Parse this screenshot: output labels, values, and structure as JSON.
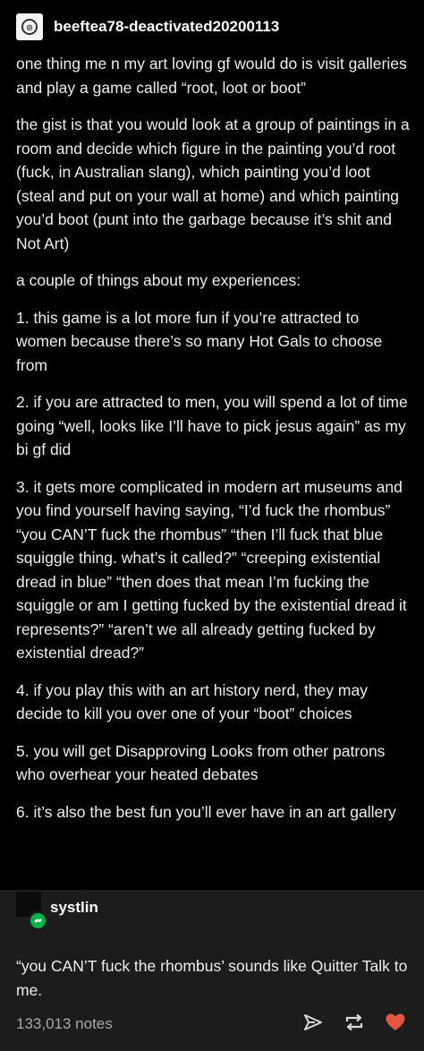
{
  "op": {
    "username": "beeftea78-deactivated20200113",
    "paragraphs": [
      "one thing me n my art loving gf would do is visit galleries and play a game called “root, loot or boot”",
      "the gist is that you would look at a group of paintings in a room and decide which figure in the painting you’d root (fuck, in Australian slang), which painting you’d loot (steal and put on your wall at home) and which painting you’d boot (punt into the garbage because it’s shit and Not Art)",
      "a couple of things about my experiences:",
      "1. this game is a lot more fun if you’re attracted to women because there’s so many Hot Gals to choose from",
      "2. if you are attracted to men, you will spend a lot of time going “well, looks like I’ll have to pick jesus again” as my bi gf did",
      "3. it gets more complicated in modern art museums and you find yourself having saying, “I’d fuck the rhombus” “you CAN’T fuck the rhombus” “then I’ll fuck that blue squiggle thing. what’s it called?” “creeping existential dread in blue” “then does that mean I’m fucking the squiggle or am I getting fucked by the existential dread it represents?” “aren’t we all already getting fucked by existential dread?”",
      "4. if you play this with an art history nerd, they may decide to kill you over one of your “boot” choices",
      "5. you will get Disapproving Looks from other patrons who overhear your heated debates",
      "6. it’s also the best fun you’ll ever have in an art gallery"
    ]
  },
  "reblog": {
    "username": "systlin",
    "text": "“you CAN’T fuck the rhombus’ sounds like Quitter Talk to me."
  },
  "footer": {
    "notes": "133,013 notes",
    "icons": [
      "share-icon",
      "reblog-icon",
      "like-icon"
    ]
  },
  "colors": {
    "background": "#000000",
    "reblog_background": "#1c1c1c",
    "text": "#ededed",
    "reblog_badge": "#00b34a",
    "like": "#e2553f",
    "notes": "#a8a8a8"
  }
}
